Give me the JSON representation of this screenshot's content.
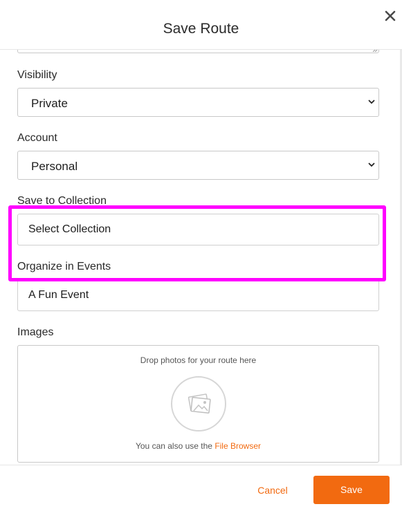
{
  "header": {
    "title": "Save Route",
    "close_icon": "close-icon"
  },
  "visibility": {
    "label": "Visibility",
    "value": "Private"
  },
  "account": {
    "label": "Account",
    "value": "Personal"
  },
  "collection": {
    "label": "Save to Collection",
    "value": "Select Collection"
  },
  "events": {
    "label": "Organize in Events",
    "value": "A Fun Event"
  },
  "images": {
    "label": "Images",
    "drop_text": "Drop photos for your route here",
    "also_text": "You can also use the",
    "link_text": "File Browser",
    "icon": "photo-stack-icon"
  },
  "footer": {
    "cancel_label": "Cancel",
    "save_label": "Save"
  },
  "colors": {
    "accent": "#f26a10",
    "highlight": "#ff00ff"
  }
}
